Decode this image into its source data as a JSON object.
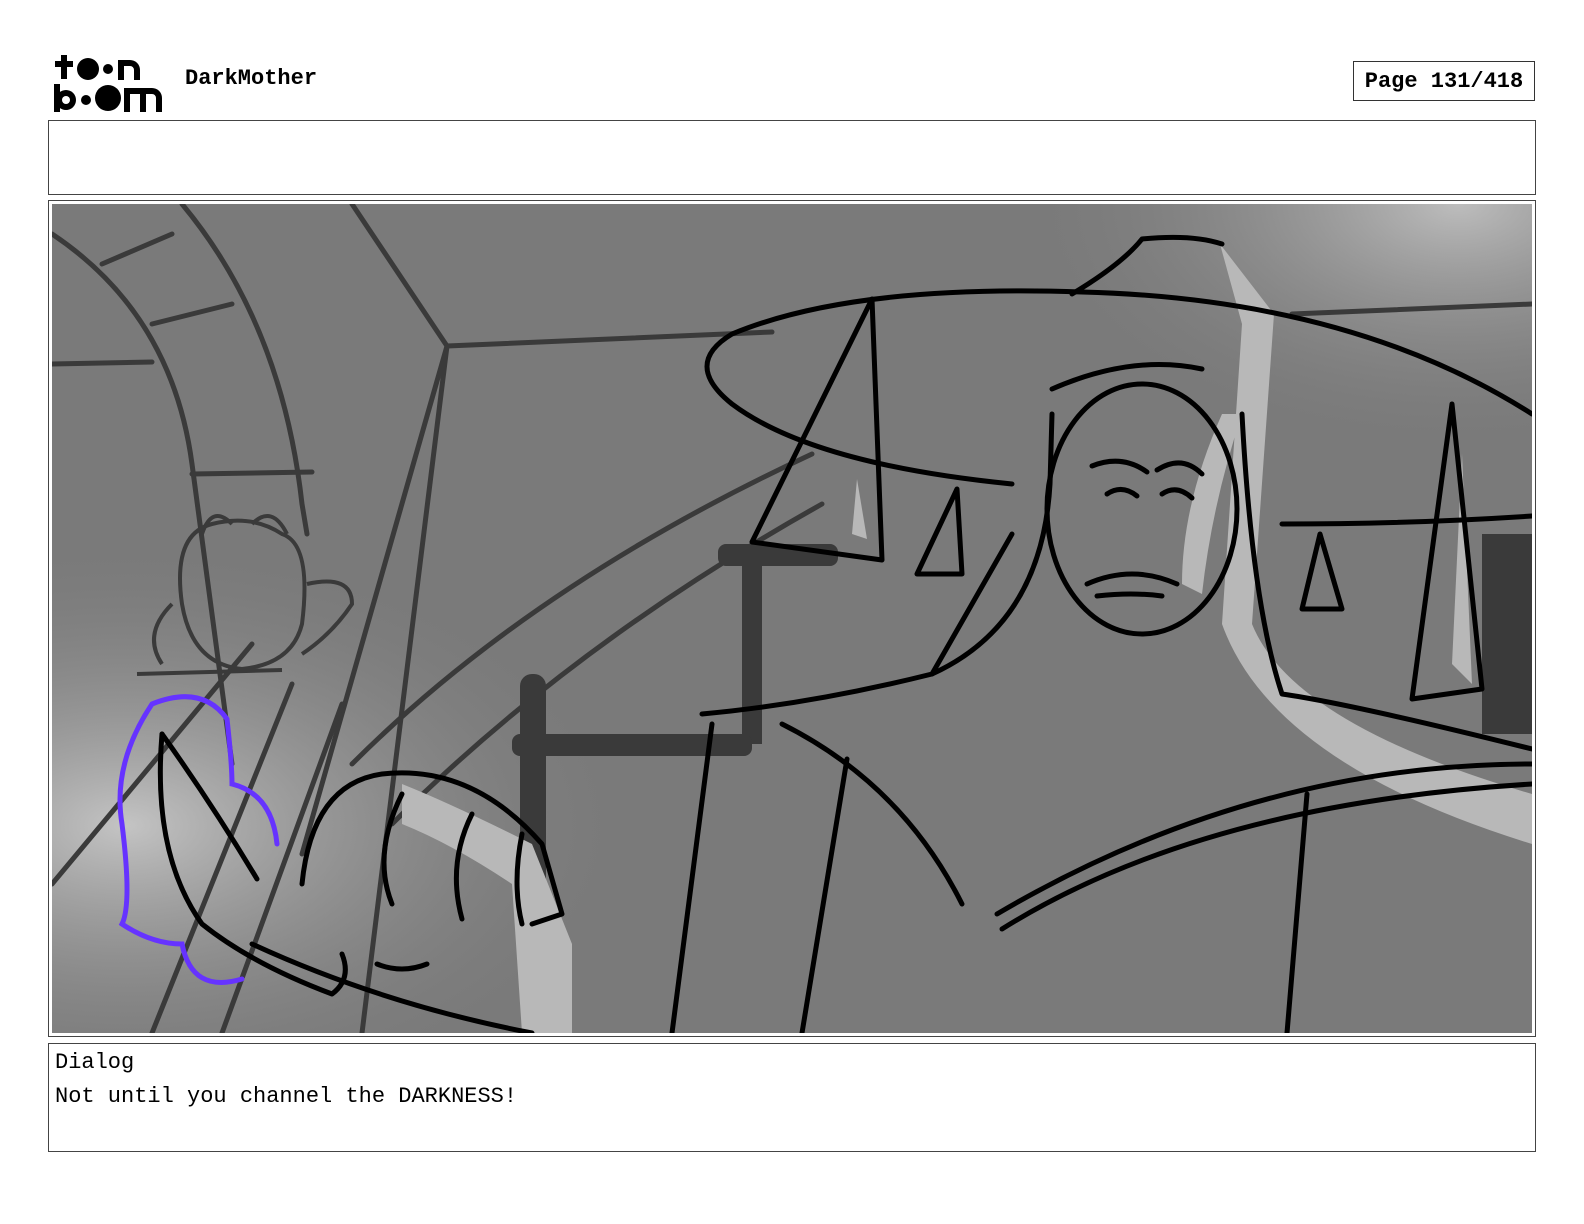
{
  "header": {
    "logo": {
      "brand": "toon boom",
      "icon": "toon-boom-logo-icon"
    },
    "project_title": "DarkMother",
    "page_label": "Page 131/418"
  },
  "notes": {
    "text": ""
  },
  "panel": {
    "icon": "storyboard-sketch-panel",
    "colors": {
      "background": "#7a7a7a",
      "line": "#000000",
      "highlight": "#b8b8b8",
      "accent_stroke": "#6633ff"
    }
  },
  "dialog": {
    "heading": "Dialog",
    "text": "Not until you channel the DARKNESS!"
  }
}
